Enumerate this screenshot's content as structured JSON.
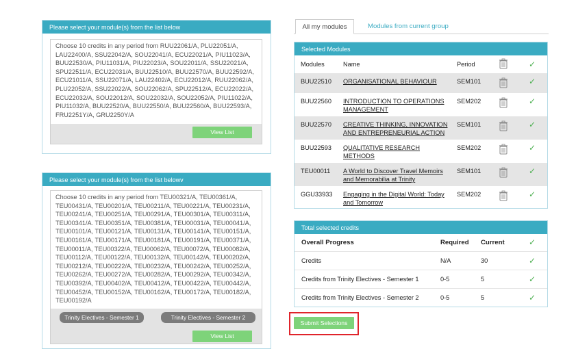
{
  "left_panel_1": {
    "header": "Please select your module(s) from the list below",
    "text": "Choose 10 credits in any period from RUU22061/A, PLU22051/A, LAU22400/A, SSU22042/A, SOU22041/A, ECU22021/A, PIU11023/A, BUU22530/A, PIU11031/A, PIU22023/A, SOU22011/A, SSU22021/A, SPU22511/A, ECU22031/A, BUU22510/A, BUU22570/A, BUU22592/A, ECU21011/A, SSU22071/A, LAU22402/A, ECU22012/A, RUU22062/A, PLU22052/A, SSU22022/A, SOU22062/A, SPU22512/A, ECU22022/A, ECU22032/A, SOU22012/A, SOU22032/A, SOU22052/A, PIU11022/A, PIU11032/A, BUU22520/A, BUU22550/A, BUU22560/A, BUU22593/A, FRU2251Y/A, GRU2250Y/A",
    "button": "View List"
  },
  "left_panel_2": {
    "header": "Please select your module(s) from the list belowv",
    "text": "Choose 10 credits in any period from TEU00321/A, TEU00361/A, TEU00431/A, TEU00201/A, TEU00211/A, TEU00221/A, TEU00231/A, TEU00241/A, TEU00251/A, TEU00291/A, TEU00301/A, TEU00311/A, TEU00341/A. TEU00351/A, TEU00381/A, TEU00031/A, TEU00041/A, TEU00101/A, TEU00121/A, TEU00131/A, TEU00141/A, TEU00151/A, TEU00161/A, TEU00171/A, TEU00181/A, TEU00191/A, TEU00371/A, TEU00011/A, TEU00322/A, TEU00062/A, TEU00072/A, TEU00082/A, TEU00112/A, TEU00122/A, TEU00132/A, TEU00142/A, TEU00202/A, TEU00212/A, TEU00222/A, TEU00232/A, TEU00242/A, TEU00252/A, TEU00262/A, TEU00272/A, TEU00282/A, TEU00292/A, TEU00342/A, TEU00392/A, TEU00402/A, TEU00412/A, TEU00422/A, TEU00442/A, TEU00452/A, TEU00152/A, TEU00162/A, TEU00172/A, TEU00182/A, TEU00192/A",
    "filter_buttons": [
      "Trinity Electives - Semester 1",
      "Trinity Electives - Semester 2"
    ],
    "button": "View List"
  },
  "tabs": {
    "active": "All my modules",
    "other": "Modules from current group"
  },
  "selected_modules": {
    "header": "Selected Modules",
    "columns": [
      "Modules",
      "Name",
      "Period"
    ],
    "rows": [
      {
        "code": "BUU22510",
        "name": "ORGANISATIONAL BEHAVIOUR",
        "period": "SEM101"
      },
      {
        "code": "BUU22560",
        "name": "INTRODUCTION TO OPERATIONS MANAGEMENT",
        "period": "SEM202"
      },
      {
        "code": "BUU22570",
        "name": "CREATIVE THINKING, INNOVATION AND ENTREPRENEURIAL ACTION",
        "period": "SEM101"
      },
      {
        "code": "BUU22593",
        "name": "QUALITATIVE RESEARCH METHODS",
        "period": "SEM202"
      },
      {
        "code": "TEU00011",
        "name": "A World to Discover Travel Memoirs and Memorabilia at Trinity",
        "period": "SEM101"
      },
      {
        "code": "GGU33933",
        "name": " Engaging in the Digital World: Today and Tomorrow",
        "period": "SEM202"
      }
    ],
    "icons": {
      "trash": "trash-icon",
      "check": "checkmark-icon"
    }
  },
  "credits": {
    "header": "Total selected credits",
    "columns": [
      "Overall Progress",
      "Required",
      "Current"
    ],
    "rows": [
      {
        "label": "Credits",
        "required": "N/A",
        "current": "30"
      },
      {
        "label": "Credits from Trinity Electives - Semester 1",
        "required": "0-5",
        "current": "5"
      },
      {
        "label": "Credits from Trinity Electives - Semester 2",
        "required": "0-5",
        "current": "5"
      }
    ]
  },
  "submit": {
    "label": "Submit Selections"
  },
  "colors": {
    "accent": "#3aabc2",
    "green": "#7ed37a",
    "check": "#4caf50",
    "highlight": "#e0242b"
  }
}
